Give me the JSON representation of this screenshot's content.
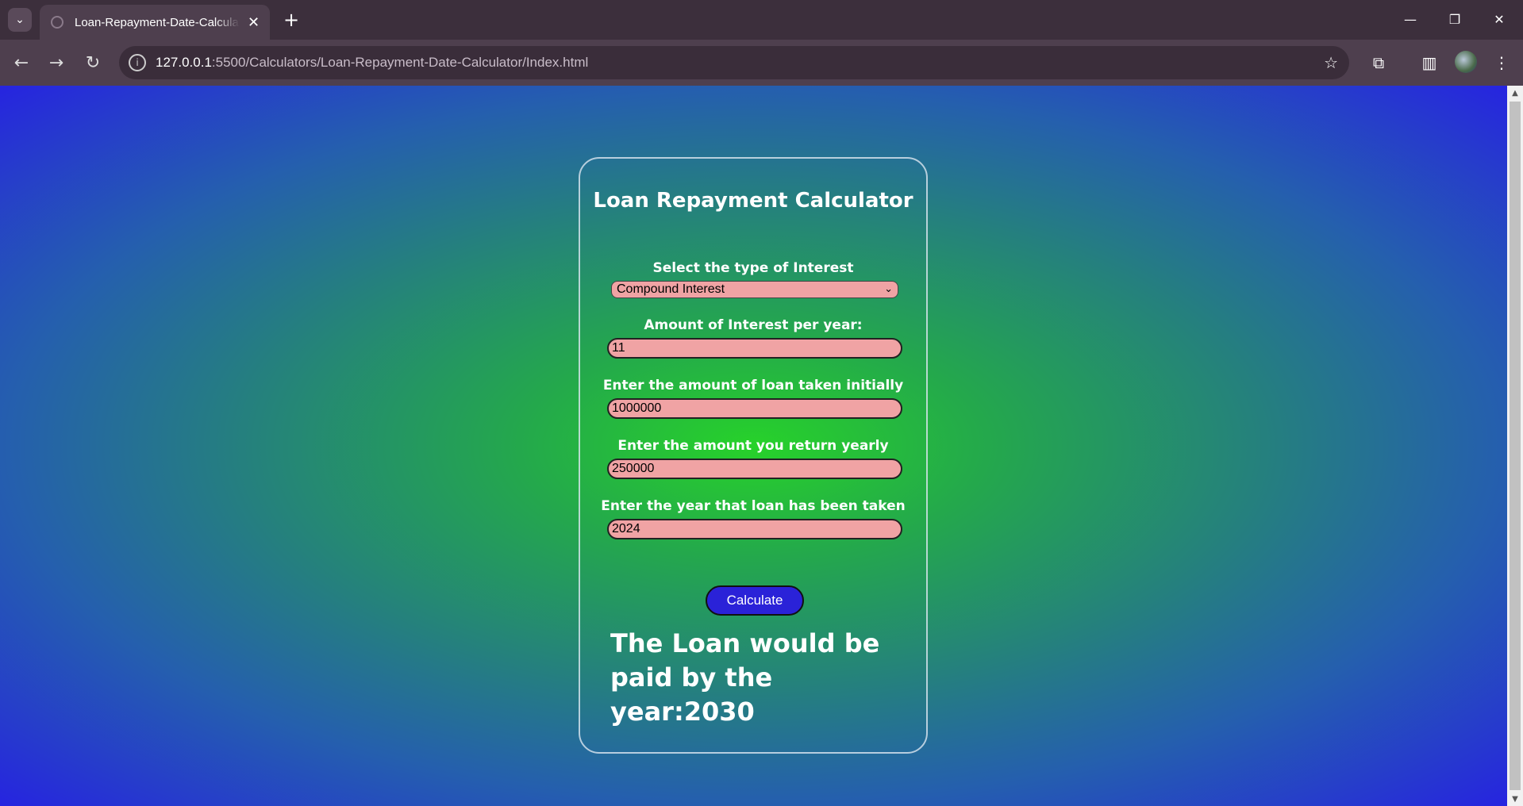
{
  "browser": {
    "tab_title": "Loan-Repayment-Date-Calculator",
    "url_host": "127.0.0.1",
    "url_path": ":5500/Calculators/Loan-Repayment-Date-Calculator/Index.html"
  },
  "page": {
    "title": "Loan Repayment Calculator",
    "interest_type": {
      "label": "Select the type of Interest",
      "selected": "Compound Interest"
    },
    "interest_rate": {
      "label": "Amount of Interest per year:",
      "value": "11"
    },
    "loan_amount": {
      "label": "Enter the amount of loan taken initially",
      "value": "1000000"
    },
    "yearly_return": {
      "label": "Enter the amount you return yearly",
      "value": "250000"
    },
    "start_year": {
      "label": "Enter the year that loan has been taken",
      "value": "2024"
    },
    "calculate_label": "Calculate",
    "result_text": "The Loan would be paid by the year:2030"
  },
  "colors": {
    "input_bg": "#f0a3a4",
    "button_bg": "#2a22d8",
    "gradient_center": "#27d22a",
    "gradient_edge": "#2624e0"
  }
}
